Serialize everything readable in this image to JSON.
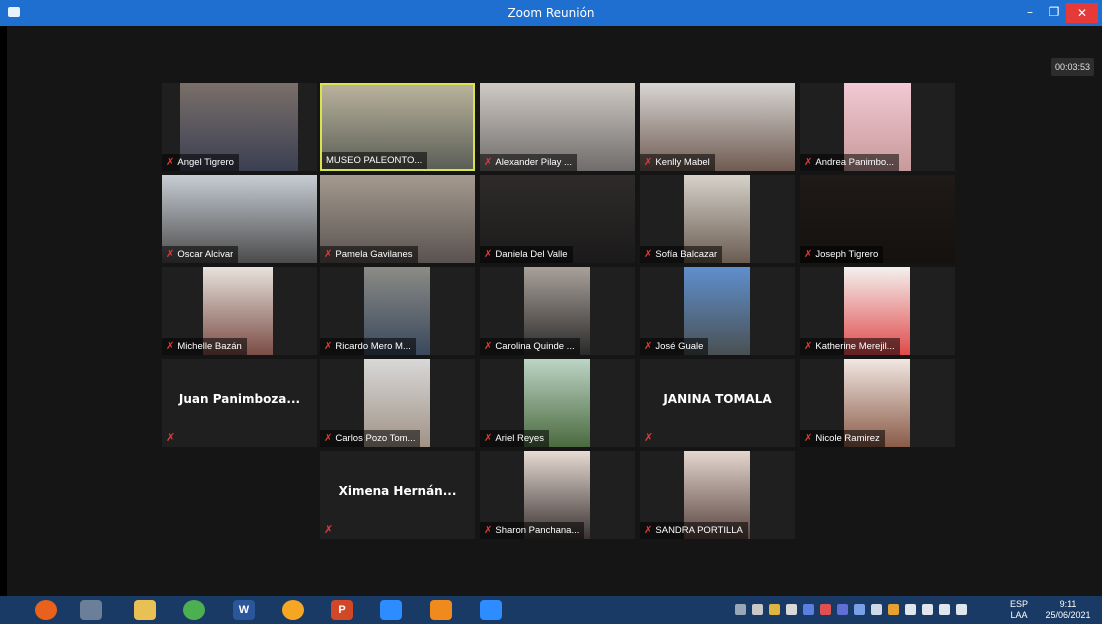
{
  "window": {
    "title": "Zoom Reunión",
    "minimize": "–",
    "maximize": "❐",
    "close": "✕"
  },
  "timer": "00:03:53",
  "participants": [
    {
      "name": "Angel Tigrero",
      "muted": true
    },
    {
      "name": "MUSEO PALEONTO...",
      "muted": false,
      "active": true
    },
    {
      "name": "Alexander Pilay ...",
      "muted": true
    },
    {
      "name": "Kenlly Mabel",
      "muted": true
    },
    {
      "name": "Andrea Panimbo...",
      "muted": true
    },
    {
      "name": "Oscar Alcivar",
      "muted": true
    },
    {
      "name": "Pamela Gavilanes",
      "muted": true
    },
    {
      "name": "Daniela Del Valle",
      "muted": true
    },
    {
      "name": "Sofía Balcazar",
      "muted": true
    },
    {
      "name": "Joseph Tigrero",
      "muted": true
    },
    {
      "name": "Michelle Bazán",
      "muted": true
    },
    {
      "name": "Ricardo Mero M...",
      "muted": true
    },
    {
      "name": "Carolina Quinde ...",
      "muted": true
    },
    {
      "name": "José Guale",
      "muted": true
    },
    {
      "name": "Katherine Merejil...",
      "muted": true
    },
    {
      "name": "Juan  Panimboza...",
      "muted": true,
      "video_off": true
    },
    {
      "name": "Carlos Pozo Tom...",
      "muted": true
    },
    {
      "name": "Ariel Reyes",
      "muted": true
    },
    {
      "name": "JANINA TOMALA",
      "muted": true,
      "video_off": true
    },
    {
      "name": "Nicole Ramirez",
      "muted": true
    },
    {
      "name": "Ximena  Hernán...",
      "muted": true,
      "video_off": true
    },
    {
      "name": "Sharon Panchana...",
      "muted": true
    },
    {
      "name": "SANDRA PORTILLA",
      "muted": true
    }
  ],
  "icons": {
    "mic_muted": "mic-muted-icon",
    "glyph": "✗"
  },
  "taskbar": {
    "apps": [
      {
        "name": "firefox-icon",
        "label": "",
        "color": "#e8621c"
      },
      {
        "name": "app-icon",
        "label": "",
        "color": "#6b7f99"
      },
      {
        "name": "file-explorer-icon",
        "label": "",
        "color": "#e9c054"
      },
      {
        "name": "chrome-icon",
        "label": "",
        "color": "#4caf50"
      },
      {
        "name": "word-icon",
        "label": "W",
        "color": "#2b579a"
      },
      {
        "name": "browser-icon",
        "label": "",
        "color": "#f5a623"
      },
      {
        "name": "powerpoint-icon",
        "label": "P",
        "color": "#d24726"
      },
      {
        "name": "zoom-icon",
        "label": "",
        "color": "#2d8cff"
      },
      {
        "name": "vlc-icon",
        "label": "",
        "color": "#f08a1c"
      },
      {
        "name": "zoom-meeting-icon",
        "label": "",
        "color": "#2d8cff"
      }
    ],
    "lang": "ESP",
    "layout": "LAA",
    "time": "9:11",
    "date": "25/06/2021"
  }
}
